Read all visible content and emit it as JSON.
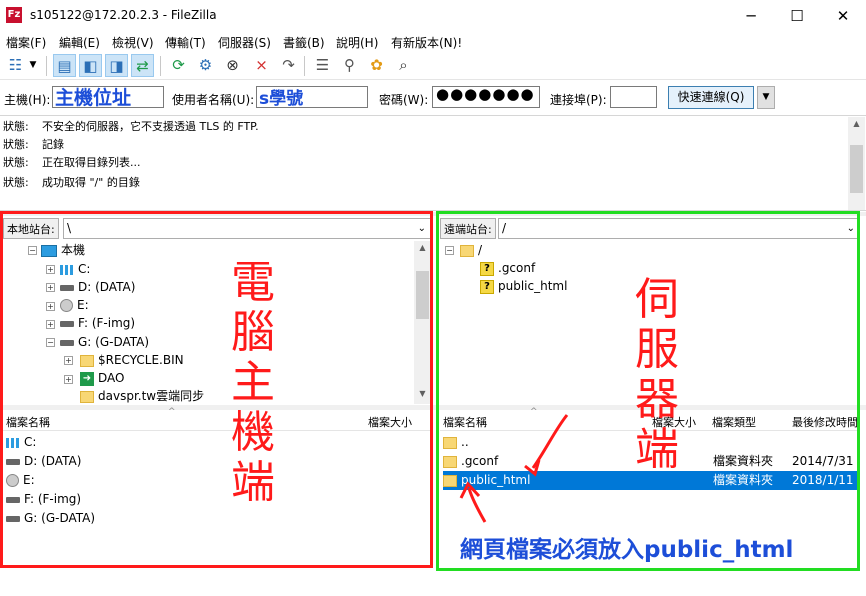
{
  "window": {
    "title": "s105122@172.20.2.3 - FileZilla",
    "app_icon_glyph": "Fz",
    "min": "─",
    "max": "☐",
    "close": "✕"
  },
  "menu": [
    "檔案(F)",
    "編輯(E)",
    "檢視(V)",
    "傳輸(T)",
    "伺服器(S)",
    "書籤(B)",
    "說明(H)",
    "有新版本(N)!"
  ],
  "quickconnect": {
    "host_label": "主機(H):",
    "host_value": "主機位址",
    "user_label": "使用者名稱(U):",
    "user_value": "s學號",
    "pass_label": "密碼(W):",
    "pass_value": "●●●●●●●",
    "port_label": "連接埠(P):",
    "port_value": "",
    "connect_button": "快速連線(Q)"
  },
  "log": [
    {
      "label": "狀態:",
      "text": "不安全的伺服器，它不支援透過 TLS 的 FTP."
    },
    {
      "label": "狀態:",
      "text": "記錄"
    },
    {
      "label": "狀態:",
      "text": "正在取得目錄列表..."
    },
    {
      "label": "狀態:",
      "text": "成功取得 \"/\" 的目錄"
    }
  ],
  "local": {
    "site_label": "本地站台:",
    "site_path": "\\",
    "tree": [
      {
        "label": "本機",
        "icon": "pc-icon"
      },
      {
        "label": "C:",
        "icon": "net-drive-icon"
      },
      {
        "label": "D: (DATA)",
        "icon": "drive-icon"
      },
      {
        "label": "E:",
        "icon": "cd-icon"
      },
      {
        "label": "F: (F-img)",
        "icon": "drive-icon"
      },
      {
        "label": "G: (G-DATA)",
        "icon": "drive-icon"
      },
      {
        "label": "$RECYCLE.BIN",
        "icon": "folder-icon"
      },
      {
        "label": "DAO",
        "icon": "shortcut-icon"
      },
      {
        "label": "davspr.tw雲端同步",
        "icon": "folder-icon"
      }
    ],
    "columns": [
      "檔案名稱",
      "檔案大小"
    ],
    "files": [
      "C:",
      "D: (DATA)",
      "E:",
      "F: (F-img)",
      "G: (G-DATA)"
    ],
    "annotation": "電腦主機端"
  },
  "remote": {
    "site_label": "遠端站台:",
    "site_path": "/",
    "tree": [
      {
        "label": "/",
        "icon": "folder-icon"
      },
      {
        "label": ".gconf",
        "icon": "unknown-folder-icon"
      },
      {
        "label": "public_html",
        "icon": "unknown-folder-icon"
      }
    ],
    "columns": [
      "檔案名稱",
      "檔案大小",
      "檔案類型",
      "最後修改時間"
    ],
    "files": [
      {
        "name": "..",
        "size": "",
        "type": "",
        "modified": ""
      },
      {
        "name": ".gconf",
        "size": "",
        "type": "檔案資料夾",
        "modified": "2014/7/31"
      },
      {
        "name": "public_html",
        "size": "",
        "type": "檔案資料夾",
        "modified": "2018/1/11"
      }
    ],
    "annotation": "伺服器端"
  },
  "note": "網頁檔案必須放入public_html",
  "colors": {
    "red": "#ff1a1a",
    "green": "#22dd22",
    "blue": "#1d4ed8",
    "select": "#0078d7"
  }
}
